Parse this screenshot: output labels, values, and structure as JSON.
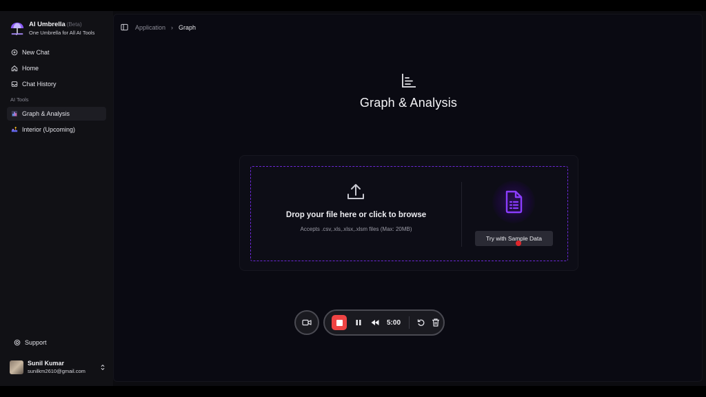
{
  "brand": {
    "name": "AI Umbrella",
    "badge": "Beta",
    "tagline": "One Umbrella for All AI Tools"
  },
  "sidebar": {
    "items": [
      {
        "label": "New Chat",
        "icon": "chat-plus-icon"
      },
      {
        "label": "Home",
        "icon": "home-icon"
      },
      {
        "label": "Chat History",
        "icon": "inbox-icon"
      }
    ],
    "section_label": "AI Tools",
    "tools": [
      {
        "label": "Graph & Analysis",
        "icon": "graph-tool-icon",
        "active": true
      },
      {
        "label": "Interior (Upcoming)",
        "icon": "interior-tool-icon",
        "active": false
      }
    ],
    "support_label": "Support"
  },
  "user": {
    "name": "Sunil Kumar",
    "email": "sunilkm2610@gmail.com"
  },
  "breadcrumb": {
    "parent": "Application",
    "current": "Graph"
  },
  "hero": {
    "title": "Graph & Analysis",
    "icon": "bar-chart-icon"
  },
  "upload": {
    "title": "Drop your file here or click to browse",
    "subtitle": "Accepts .csv,.xls,.xlsx,.xlsm files (Max: 20MB)",
    "sample_button": "Try with Sample Data"
  },
  "recorder": {
    "timer": "5:00"
  },
  "colors": {
    "accent": "#7c3aed",
    "record": "#ef4444",
    "background": "#0a0a12"
  }
}
